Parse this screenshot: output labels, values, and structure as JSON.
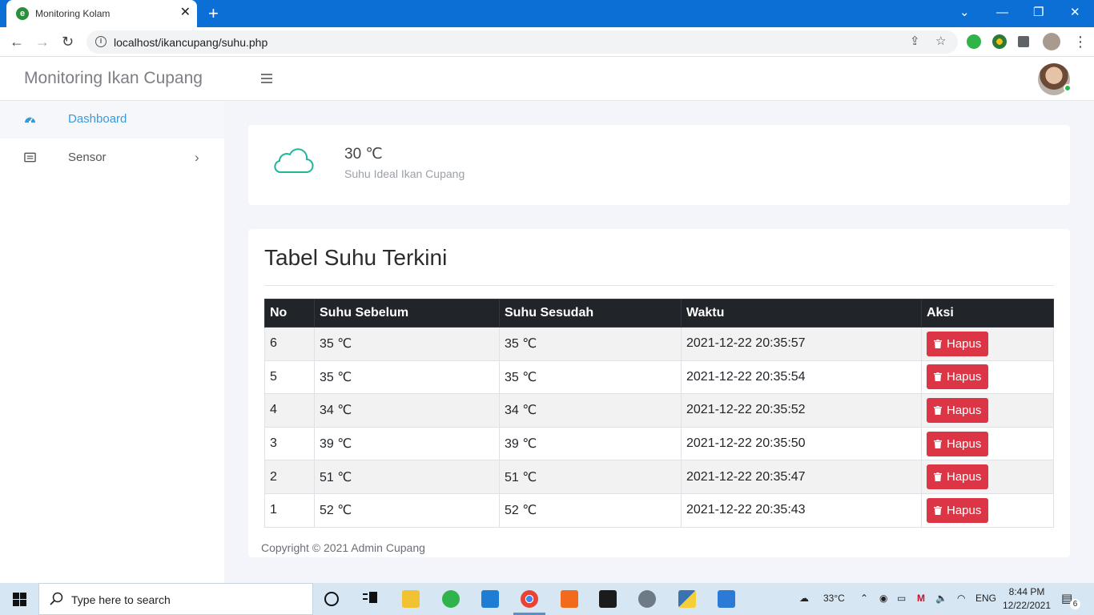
{
  "browser": {
    "tab_title": "Monitoring Kolam",
    "url": "localhost/ikancupang/suhu.php"
  },
  "app": {
    "brand": "Monitoring Ikan Cupang"
  },
  "sidebar": {
    "items": [
      {
        "label": "Dashboard",
        "icon": "dashboard-gauge-icon",
        "active": true
      },
      {
        "label": "Sensor",
        "icon": "sensor-list-icon",
        "active": false
      }
    ]
  },
  "info_card": {
    "icon": "cloud-icon",
    "value": "30 ℃",
    "label": "Suhu Ideal Ikan Cupang"
  },
  "table_card": {
    "title": "Tabel Suhu Terkini",
    "headers": [
      "No",
      "Suhu Sebelum",
      "Suhu Sesudah",
      "Waktu",
      "Aksi"
    ],
    "rows": [
      {
        "no": "6",
        "sebelum": "35 ℃",
        "sesudah": "35 ℃",
        "waktu": "2021-12-22 20:35:57",
        "aksi": "Hapus"
      },
      {
        "no": "5",
        "sebelum": "35 ℃",
        "sesudah": "35 ℃",
        "waktu": "2021-12-22 20:35:54",
        "aksi": "Hapus"
      },
      {
        "no": "4",
        "sebelum": "34 ℃",
        "sesudah": "34 ℃",
        "waktu": "2021-12-22 20:35:52",
        "aksi": "Hapus"
      },
      {
        "no": "3",
        "sebelum": "39 ℃",
        "sesudah": "39 ℃",
        "waktu": "2021-12-22 20:35:50",
        "aksi": "Hapus"
      },
      {
        "no": "2",
        "sebelum": "51 ℃",
        "sesudah": "51 ℃",
        "waktu": "2021-12-22 20:35:47",
        "aksi": "Hapus"
      },
      {
        "no": "1",
        "sebelum": "52 ℃",
        "sesudah": "52 ℃",
        "waktu": "2021-12-22 20:35:43",
        "aksi": "Hapus"
      }
    ]
  },
  "footer": {
    "copyright": "Copyright © 2021 Admin Cupang"
  },
  "taskbar": {
    "search_placeholder": "Type here to search",
    "weather": "33°C",
    "language": "ENG",
    "time": "8:44 PM",
    "date": "12/22/2021",
    "notification_count": "6"
  },
  "colors": {
    "titlebar": "#0b6fd6",
    "active_link": "#3a9ad9",
    "danger": "#dc3545",
    "table_header": "#212529",
    "cloud": "#1fb79b"
  }
}
